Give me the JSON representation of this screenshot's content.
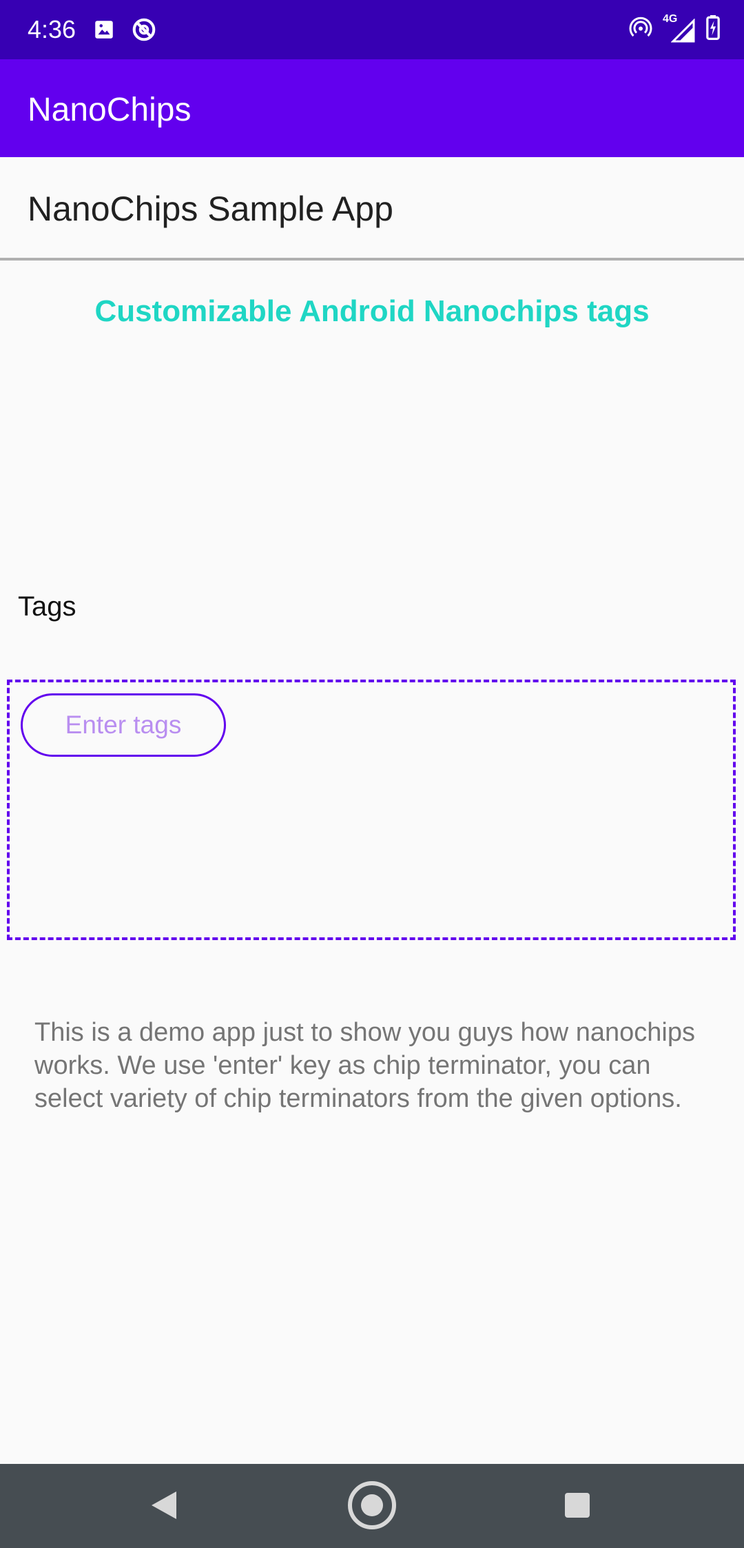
{
  "status_bar": {
    "time": "4:36",
    "icons_left": [
      "image-icon",
      "at-sign-icon"
    ],
    "icons_right": [
      "hotspot-icon",
      "signal-icon",
      "battery-icon"
    ],
    "network_label": "4G"
  },
  "app_bar": {
    "title": "NanoChips"
  },
  "subheader": {
    "title": "NanoChips Sample App"
  },
  "main": {
    "headline": "Customizable Android Nanochips tags",
    "tags_label": "Tags",
    "chip_input": {
      "placeholder": "Enter tags",
      "value": ""
    },
    "description": "This is a demo app just to show you guys how nanochips works. We use 'enter' key as chip terminator, you can select variety of chip terminators from the given options."
  },
  "nav_bar": {
    "buttons": [
      "back-icon",
      "home-icon",
      "recents-icon"
    ]
  },
  "colors": {
    "status_bar": "#3700b3",
    "app_bar": "#6200ee",
    "accent_text": "#1fd6c4",
    "nav_bar": "#464d52"
  }
}
